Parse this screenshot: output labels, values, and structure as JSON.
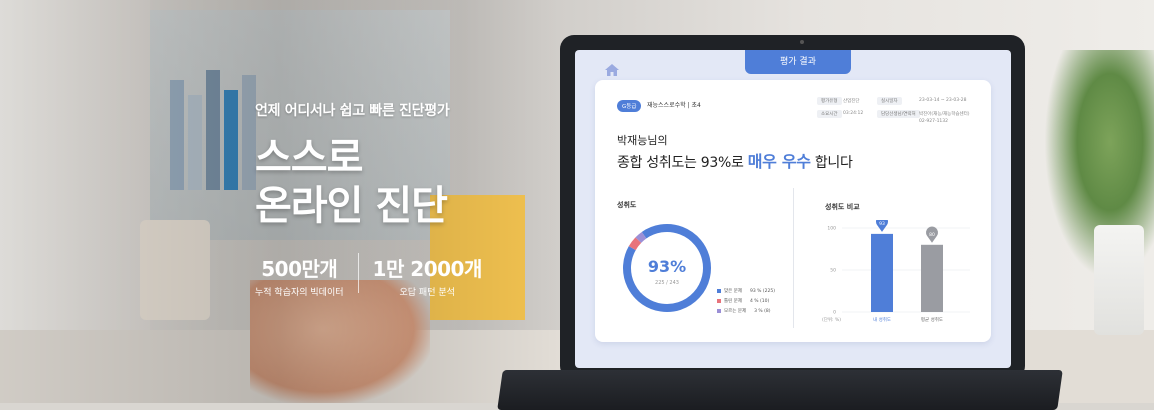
{
  "hero": {
    "subtitle": "언제 어디서나 쉽고 빠른 진단평가",
    "headline_line1": "스스로",
    "headline_line2": "온라인 진단",
    "stats": [
      {
        "value": "500만개",
        "caption": "누적 학습자의 빅데이터"
      },
      {
        "value": "1만 2000개",
        "caption": "오답 패턴 분석"
      }
    ]
  },
  "laptop": {
    "tab_label": "평가 결과",
    "grade_badge": "G등급",
    "course": "재능스스로수학 | 초4",
    "info": {
      "pill1": "평가유형",
      "val1": "산업진단",
      "pill2": "실시일자",
      "val2": "23-03-14 ~ 23-03-28",
      "pill3": "소요시간",
      "val3": "03:24:12",
      "pill4": "담당선생님/연락처",
      "val4": "박진아(재능/재능학습센터)",
      "phone": "02-927-1132"
    },
    "name_line": "박재능님의",
    "result_prefix": "종합 성취도는 93%로 ",
    "result_emphasis": "매우 우수",
    "result_suffix": " 합니다",
    "achievement_title": "성취도",
    "compare_title": "성취도 비교",
    "donut": {
      "percent_label": "93%",
      "count_label": "225 / 243"
    },
    "legend": [
      {
        "label": "맞은 문제",
        "value": "93 % (225)",
        "color": "#4f7ed8"
      },
      {
        "label": "틀린 문제",
        "value": "4 % (10)",
        "color": "#e8737b"
      },
      {
        "label": "모르는 문제",
        "value": "3 % (8)",
        "color": "#9b8fd6"
      }
    ],
    "bar_chart": {
      "ylabel": "(단위: %)",
      "ticks": [
        "100",
        "50",
        "0"
      ],
      "bars": [
        {
          "label": "내 성취도",
          "value": 93,
          "marker": "93",
          "color": "#4f7ed8"
        },
        {
          "label": "평균 성취도",
          "value": 80,
          "marker": "80",
          "color": "#9a9ca2"
        }
      ]
    }
  },
  "colors": {
    "accent": "#4f7ed8",
    "wrong": "#e8737b",
    "unknown": "#9b8fd6"
  }
}
